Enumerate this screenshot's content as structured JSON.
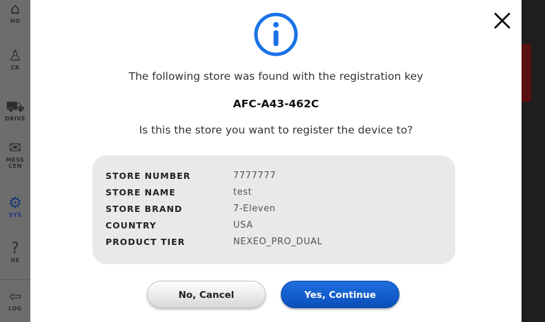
{
  "modal": {
    "registration_text": "The following store was found with the registration key",
    "registration_key": "AFC-A43-462C",
    "question": "Is this the store you want to register the device to?",
    "details": [
      {
        "label": "STORE NUMBER",
        "value": "7777777"
      },
      {
        "label": "STORE NAME",
        "value": "test"
      },
      {
        "label": "STORE BRAND",
        "value": "7-Eleven"
      },
      {
        "label": "COUNTRY",
        "value": "USA"
      },
      {
        "label": "PRODUCT TIER",
        "value": "NEXEO_PRO_DUAL"
      }
    ],
    "cancel_label": "No, Cancel",
    "continue_label": "Yes, Continue",
    "icons": {
      "info": "info-icon",
      "close": "close-icon"
    },
    "colors": {
      "accent": "#1a73e8",
      "primary_button": "#0a55c4"
    }
  },
  "sidebar": {
    "items": [
      {
        "label": "HO",
        "icon": "home-icon"
      },
      {
        "label": "CR",
        "icon": "user-icon"
      },
      {
        "label": "DRIVE",
        "icon": "car-icon"
      },
      {
        "label": "MESS\nCEN",
        "icon": "message-center-icon"
      },
      {
        "label": "SYS",
        "icon": "gear-icon"
      },
      {
        "label": "HE",
        "icon": "help-icon"
      },
      {
        "label": "LOG",
        "icon": "logout-icon"
      }
    ]
  }
}
